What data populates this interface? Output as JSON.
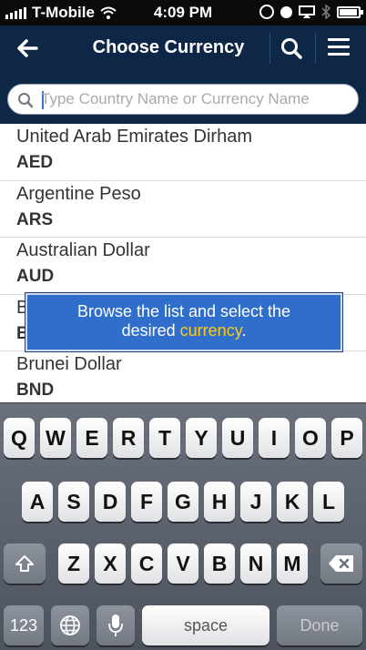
{
  "status": {
    "carrier": "T-Mobile",
    "time": "4:09 PM",
    "battery_level": 0.85
  },
  "nav": {
    "title": "Choose Currency"
  },
  "search": {
    "placeholder": "Type Country Name or Currency Name",
    "value": ""
  },
  "currencies": [
    {
      "name": "United Arab Emirates Dirham",
      "code": "AED"
    },
    {
      "name": "Argentine Peso",
      "code": "ARS"
    },
    {
      "name": "Australian Dollar",
      "code": "AUD"
    },
    {
      "name": "B",
      "code": "B"
    },
    {
      "name": "Brunei Dollar",
      "code": "BND"
    }
  ],
  "tooltip": {
    "text_before": "Browse the list and select the",
    "text_mid": "desired",
    "highlight": "currency",
    "text_after": ".",
    "highlight_color": "#ffcc1a"
  },
  "keyboard": {
    "row1": [
      "Q",
      "W",
      "E",
      "R",
      "T",
      "Y",
      "U",
      "I",
      "O",
      "P"
    ],
    "row2": [
      "A",
      "S",
      "D",
      "F",
      "G",
      "H",
      "J",
      "K",
      "L"
    ],
    "row3": [
      "Z",
      "X",
      "C",
      "V",
      "B",
      "N",
      "M"
    ],
    "numbers_label": "123",
    "space_label": "space",
    "done_label": "Done"
  },
  "colors": {
    "navbar": "#0e2747",
    "tooltip": "#2f6fcb"
  }
}
